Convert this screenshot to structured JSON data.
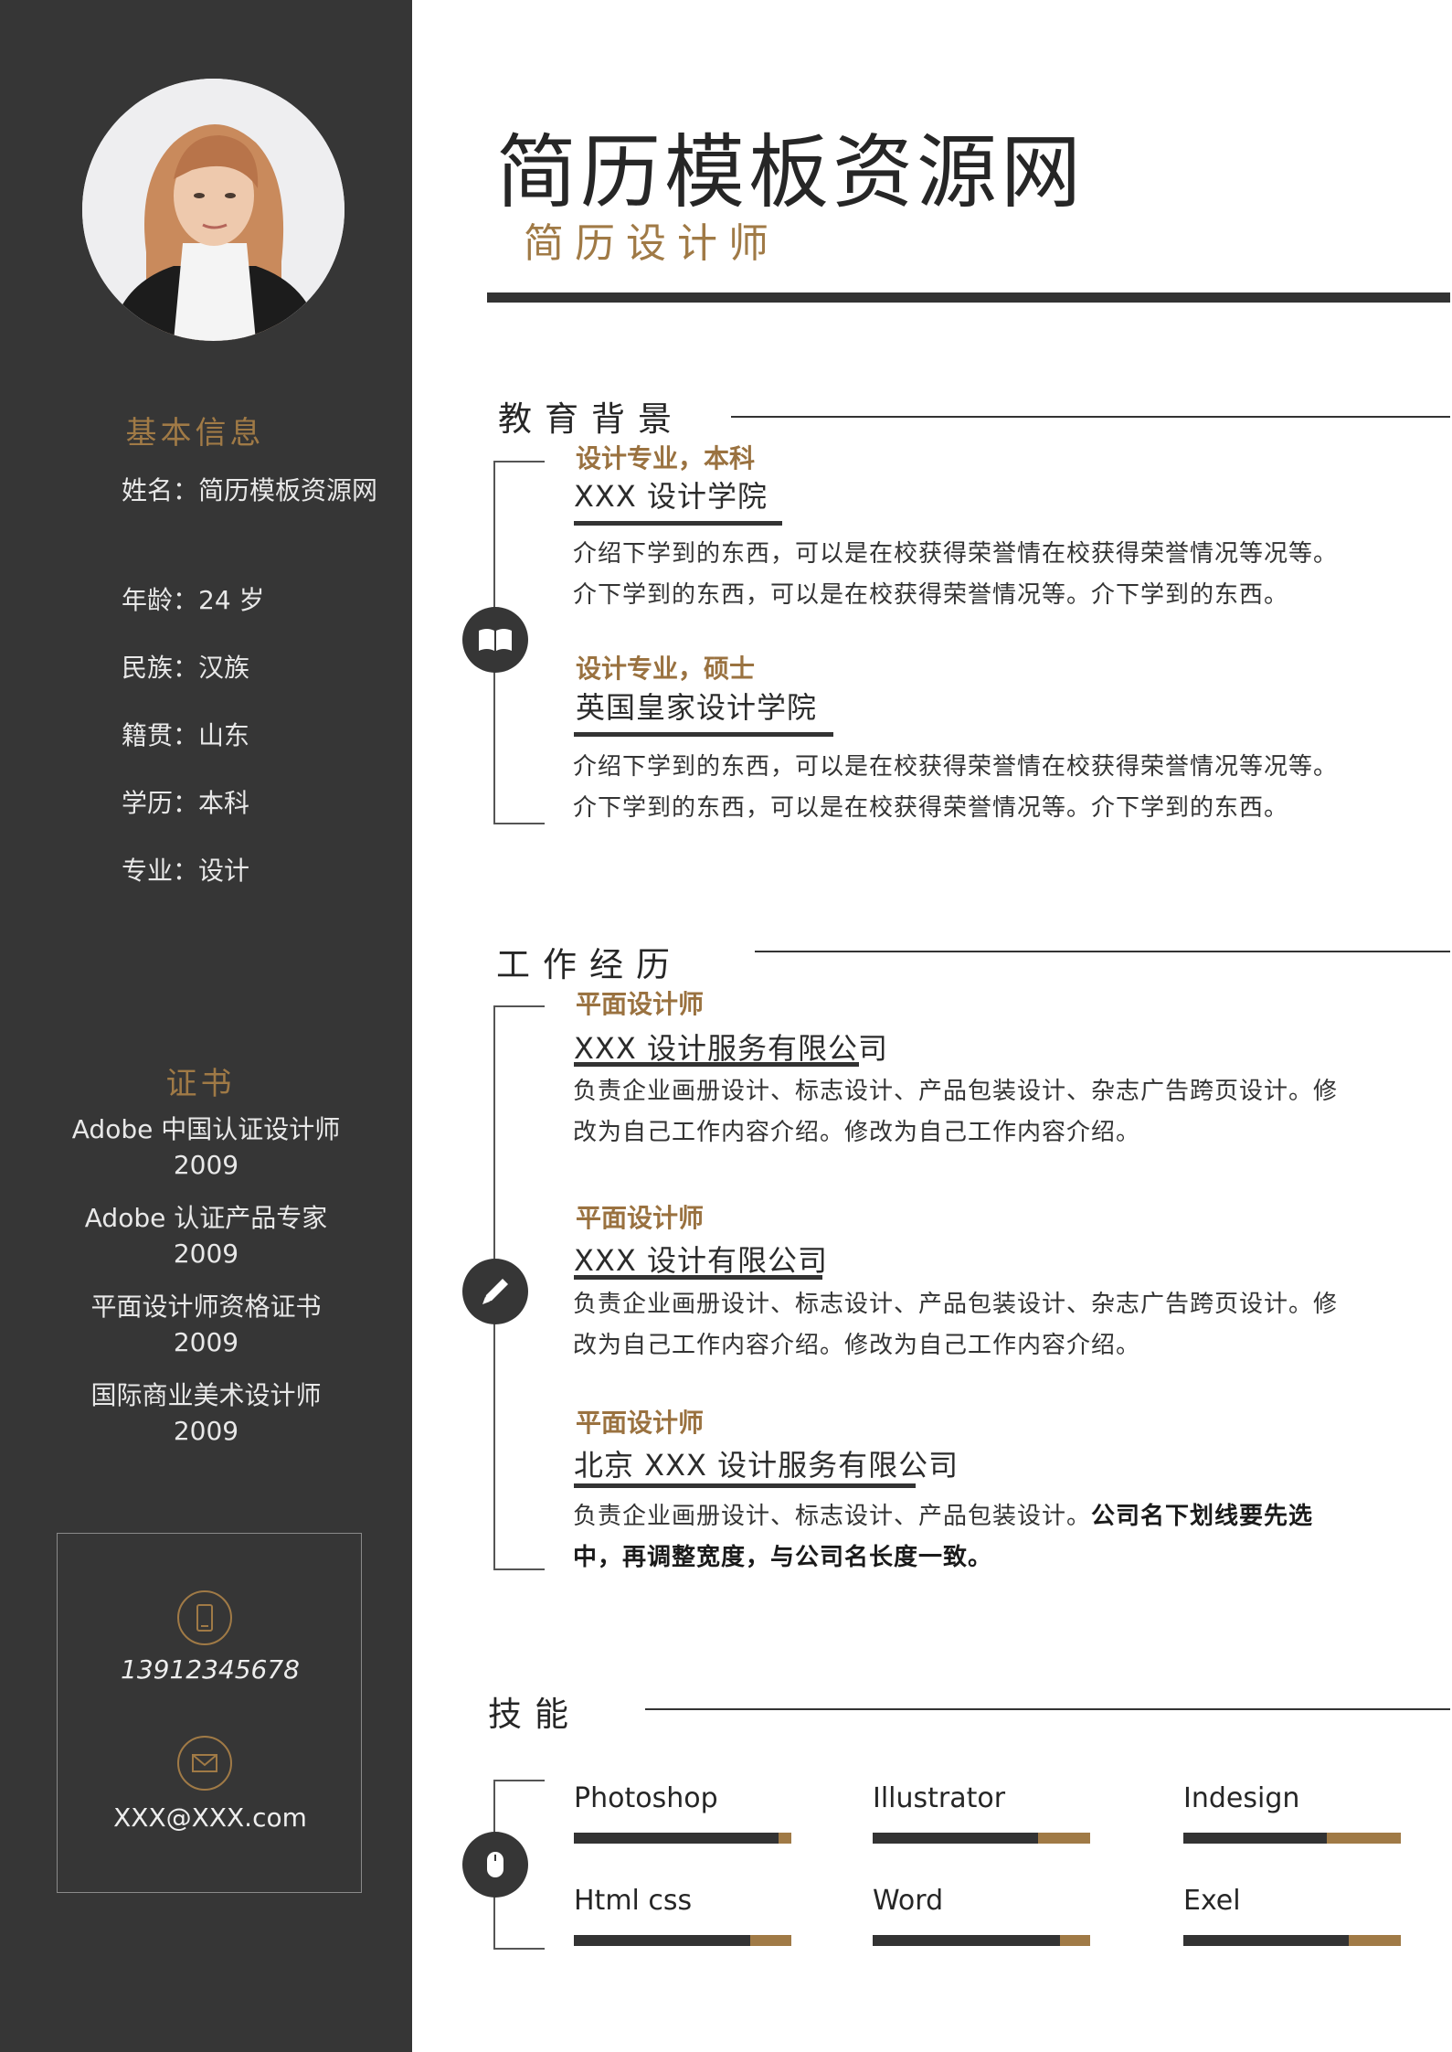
{
  "header": {
    "title": "简历模板资源网",
    "subtitle": "简历设计师"
  },
  "sidebar": {
    "basic_title": "基本信息",
    "info": [
      "姓名：简历模板资源网",
      "年龄：24 岁",
      "民族：汉族",
      "籍贯：山东",
      "学历：本科",
      "专业：设计"
    ],
    "cert_title": "证书",
    "certs": [
      {
        "name": "Adobe 中国认证设计师",
        "year": "2009"
      },
      {
        "name": "Adobe 认证产品专家",
        "year": "2009"
      },
      {
        "name": "平面设计师资格证书",
        "year": "2009"
      },
      {
        "name": "国际商业美术设计师",
        "year": "2009"
      }
    ],
    "contact": {
      "phone": "13912345678",
      "email": "XXX@XXX.com"
    }
  },
  "education": {
    "title": "教育背景",
    "items": [
      {
        "role": "设计专业，本科",
        "org": "XXX 设计学院",
        "desc1": "介绍下学到的东西，可以是在校获得荣誉情在校获得荣誉情况等况等。",
        "desc2": "介下学到的东西，可以是在校获得荣誉情况等。介下学到的东西。"
      },
      {
        "role": "设计专业，硕士",
        "org": "英国皇家设计学院",
        "desc1": "介绍下学到的东西，可以是在校获得荣誉情在校获得荣誉情况等况等。",
        "desc2": "介下学到的东西，可以是在校获得荣誉情况等。介下学到的东西。"
      }
    ]
  },
  "work": {
    "title": "工作经历",
    "items": [
      {
        "role": "平面设计师",
        "org": "XXX 设计服务有限公司",
        "desc1": "负责企业画册设计、标志设计、产品包装设计、杂志广告跨页设计。修",
        "desc2": "改为自己工作内容介绍。修改为自己工作内容介绍。"
      },
      {
        "role": "平面设计师",
        "org": "XXX 设计有限公司",
        "desc1": "负责企业画册设计、标志设计、产品包装设计、杂志广告跨页设计。修",
        "desc2": "改为自己工作内容介绍。修改为自己工作内容介绍。"
      },
      {
        "role": "平面设计师",
        "org": "北京 XXX 设计服务有限公司",
        "desc1": "负责企业画册设计、标志设计、产品包装设计。",
        "desc1_bold": "公司名下划线要先选",
        "desc2": "中，再调整宽度，与公司名长度一致。"
      }
    ]
  },
  "skills": {
    "title": "技能",
    "items": [
      {
        "name": "Photoshop",
        "level": 0.94
      },
      {
        "name": "Illustrator",
        "level": 0.76
      },
      {
        "name": "Indesign",
        "level": 0.66
      },
      {
        "name": "Html css",
        "level": 0.81
      },
      {
        "name": "Word",
        "level": 0.86
      },
      {
        "name": "Exel",
        "level": 0.76
      }
    ]
  },
  "colors": {
    "sidebar": "#363636",
    "accent": "#a07a46",
    "dark": "#333333"
  }
}
